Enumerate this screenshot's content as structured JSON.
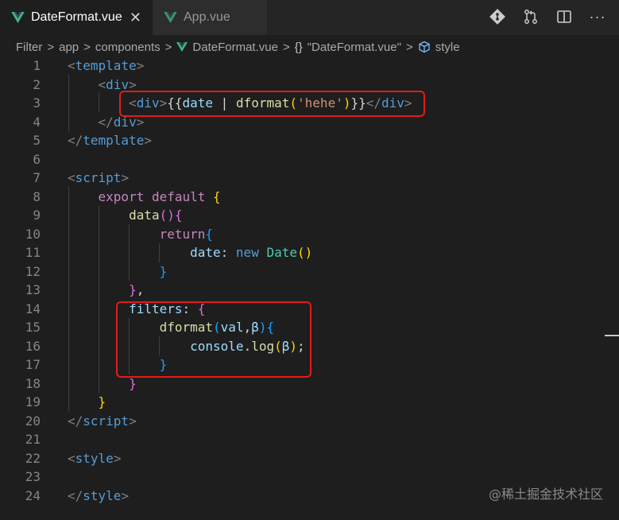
{
  "tabs": [
    {
      "label": "DateFormat.vue",
      "active": true,
      "close_glyph": "✕"
    },
    {
      "label": "App.vue",
      "active": false
    }
  ],
  "actions": [
    "git-compare-icon",
    "pull-request-icon",
    "split-editor-icon",
    "more-icon"
  ],
  "more_glyph": "···",
  "breadcrumb": {
    "items": [
      "Filter",
      "app",
      "components",
      "DateFormat.vue"
    ],
    "braces_glyph": "{}",
    "component": "\"DateFormat.vue\"",
    "section": "style",
    "separator": ">"
  },
  "editor": {
    "line_numbers": [
      "1",
      "2",
      "3",
      "4",
      "5",
      "6",
      "7",
      "8",
      "9",
      "10",
      "11",
      "12",
      "13",
      "14",
      "15",
      "16",
      "17",
      "18",
      "19",
      "20",
      "21",
      "22",
      "23",
      "24"
    ],
    "lines": [
      [
        [
          "t-punct",
          "<"
        ],
        [
          "t-tag",
          "template"
        ],
        [
          "t-punct",
          ">"
        ]
      ],
      [
        [
          "t-text",
          "    "
        ],
        [
          "t-punct",
          "<"
        ],
        [
          "t-tag",
          "div"
        ],
        [
          "t-punct",
          ">"
        ]
      ],
      [
        [
          "t-text",
          "        "
        ],
        [
          "t-punct",
          "<"
        ],
        [
          "t-tag",
          "div"
        ],
        [
          "t-punct",
          ">"
        ],
        [
          "t-text",
          "{{"
        ],
        [
          "t-var",
          "date"
        ],
        [
          "t-text",
          " | "
        ],
        [
          "t-func",
          "dformat"
        ],
        [
          "b1",
          "("
        ],
        [
          "t-str",
          "'hehe'"
        ],
        [
          "b1",
          ")"
        ],
        [
          "t-text",
          "}}"
        ],
        [
          "t-punct",
          "</"
        ],
        [
          "t-tag",
          "div"
        ],
        [
          "t-punct",
          ">"
        ]
      ],
      [
        [
          "t-text",
          "    "
        ],
        [
          "t-punct",
          "</"
        ],
        [
          "t-tag",
          "div"
        ],
        [
          "t-punct",
          ">"
        ]
      ],
      [
        [
          "t-punct",
          "</"
        ],
        [
          "t-tag",
          "template"
        ],
        [
          "t-punct",
          ">"
        ]
      ],
      [],
      [
        [
          "t-punct",
          "<"
        ],
        [
          "t-tag",
          "script"
        ],
        [
          "t-punct",
          ">"
        ]
      ],
      [
        [
          "t-text",
          "    "
        ],
        [
          "t-kw",
          "export"
        ],
        [
          "t-text",
          " "
        ],
        [
          "t-kw",
          "default"
        ],
        [
          "t-text",
          " "
        ],
        [
          "b1",
          "{"
        ]
      ],
      [
        [
          "t-text",
          "        "
        ],
        [
          "t-func",
          "data"
        ],
        [
          "b2",
          "(){"
        ]
      ],
      [
        [
          "t-text",
          "            "
        ],
        [
          "t-kw",
          "return"
        ],
        [
          "b3",
          "{"
        ]
      ],
      [
        [
          "t-text",
          "                "
        ],
        [
          "t-var",
          "date"
        ],
        [
          "t-text",
          ": "
        ],
        [
          "t-blue",
          "new"
        ],
        [
          "t-text",
          " "
        ],
        [
          "t-class",
          "Date"
        ],
        [
          "b1",
          "()"
        ]
      ],
      [
        [
          "t-text",
          "            "
        ],
        [
          "b3",
          "}"
        ]
      ],
      [
        [
          "t-text",
          "        "
        ],
        [
          "b2",
          "}"
        ],
        [
          "t-text",
          ","
        ]
      ],
      [
        [
          "t-text",
          "        "
        ],
        [
          "t-var",
          "filters"
        ],
        [
          "t-text",
          ": "
        ],
        [
          "b2",
          "{"
        ]
      ],
      [
        [
          "t-text",
          "            "
        ],
        [
          "t-func",
          "dformat"
        ],
        [
          "b3",
          "("
        ],
        [
          "t-var",
          "val"
        ],
        [
          "t-text",
          ","
        ],
        [
          "t-var",
          "β"
        ],
        [
          "b3",
          ")"
        ],
        [
          "b3",
          "{"
        ]
      ],
      [
        [
          "t-text",
          "                "
        ],
        [
          "t-var",
          "console"
        ],
        [
          "t-text",
          "."
        ],
        [
          "t-func",
          "log"
        ],
        [
          "b1",
          "("
        ],
        [
          "t-var",
          "β"
        ],
        [
          "b1",
          ")"
        ],
        [
          "t-text",
          ";"
        ]
      ],
      [
        [
          "t-text",
          "            "
        ],
        [
          "b3",
          "}"
        ]
      ],
      [
        [
          "t-text",
          "        "
        ],
        [
          "b2",
          "}"
        ]
      ],
      [
        [
          "t-text",
          "    "
        ],
        [
          "b1",
          "}"
        ]
      ],
      [
        [
          "t-punct",
          "</"
        ],
        [
          "t-tag",
          "script"
        ],
        [
          "t-punct",
          ">"
        ]
      ],
      [],
      [
        [
          "t-punct",
          "<"
        ],
        [
          "t-tag",
          "style"
        ],
        [
          "t-punct",
          ">"
        ]
      ],
      [],
      [
        [
          "t-punct",
          "</"
        ],
        [
          "t-tag",
          "style"
        ],
        [
          "t-punct",
          ">"
        ]
      ]
    ]
  },
  "watermark": "@稀土掘金技术社区",
  "colors": {
    "editor_bg": "#1e1e1e",
    "highlight_box": "#e31b1b",
    "vue_green": "#41b883"
  }
}
